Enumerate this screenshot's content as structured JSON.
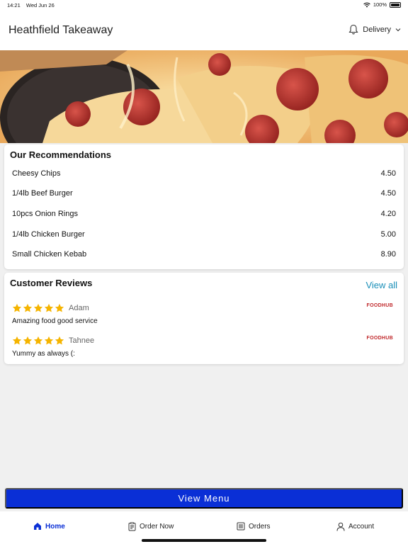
{
  "status": {
    "time": "14:21",
    "date": "Wed Jun 26",
    "battery": "100%"
  },
  "header": {
    "title": "Heathfield Takeaway",
    "delivery_label": "Delivery"
  },
  "recommendations": {
    "title": "Our Recommendations",
    "items": [
      {
        "name": "Cheesy Chips",
        "price": "4.50"
      },
      {
        "name": "1/4lb Beef Burger",
        "price": "4.50"
      },
      {
        "name": "10pcs Onion Rings",
        "price": "4.20"
      },
      {
        "name": "1/4lb Chicken Burger",
        "price": "5.00"
      },
      {
        "name": "Small Chicken Kebab",
        "price": "8.90"
      }
    ]
  },
  "reviews": {
    "title": "Customer Reviews",
    "view_all": "View all",
    "items": [
      {
        "name": "Adam",
        "text": "Amazing food good service",
        "rating": 5,
        "source": "FOODHUB"
      },
      {
        "name": "Tahnee",
        "text": "Yummy as always (:",
        "rating": 5,
        "source": "FOODHUB"
      }
    ]
  },
  "view_menu": "View Menu",
  "tabs": [
    {
      "label": "Home",
      "icon": "home-icon",
      "active": true
    },
    {
      "label": "Order Now",
      "icon": "order-icon",
      "active": false
    },
    {
      "label": "Orders",
      "icon": "orders-icon",
      "active": false
    },
    {
      "label": "Account",
      "icon": "account-icon",
      "active": false
    }
  ],
  "colors": {
    "accent": "#0a2fd6",
    "link": "#1a8fb8",
    "star": "#f5b400",
    "brand": "#c0282b"
  }
}
